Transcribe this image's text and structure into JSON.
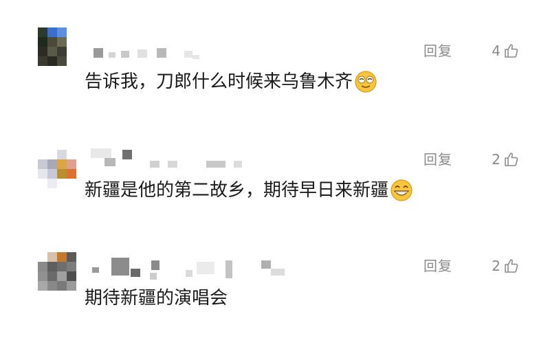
{
  "comments": [
    {
      "reply_label": "回复",
      "like_count": "4",
      "text": "告诉我，刀郎什么时候来乌鲁木齐",
      "emoji_icon": "squinting-smile-emoji-icon",
      "avatar_colors": [
        "#2b3a2b",
        "#3a6fd0",
        "#5b8fe0",
        "#ffffff",
        "#1f2a1f",
        "#4b4a3a",
        "#6a6a55",
        "#ffffff",
        "#2c2c24",
        "#5a5a48",
        "#3d3d33",
        "#ffffff",
        "#3a3a30",
        "#2a2a22",
        "#4a4a3c",
        "#ffffff"
      ]
    },
    {
      "reply_label": "回复",
      "like_count": "2",
      "text": "新疆是他的第二故乡，期待早日来新疆",
      "emoji_icon": "grinning-face-emoji-icon",
      "avatar_colors": [
        "#ffffff",
        "#ffffff",
        "#d8d8e0",
        "#ffffff",
        "#c9c9d3",
        "#a8a8b8",
        "#d9a640",
        "#e0a090",
        "#e6e6ee",
        "#c8c8d8",
        "#b89030",
        "#e07030",
        "#ffffff",
        "#ececf2",
        "#ffffff",
        "#ffffff"
      ]
    },
    {
      "reply_label": "回复",
      "like_count": "2",
      "text": "期待新疆的演唱会",
      "emoji_icon": "",
      "avatar_colors": [
        "#ffffff",
        "#d9c0a8",
        "#c8782c",
        "#5a5a5a",
        "#8a8a8a",
        "#5e5e5e",
        "#6e6e6e",
        "#7c7c7c",
        "#909090",
        "#6a6a6a",
        "#a0a0a0",
        "#4e4e4e",
        "#a8a8a8",
        "#888888",
        "#7a7a7a",
        "#9a9a9a"
      ]
    }
  ],
  "colors": {
    "meta_gray": "#8a8a8a",
    "text": "#1a1a1a",
    "background": "#ffffff"
  }
}
